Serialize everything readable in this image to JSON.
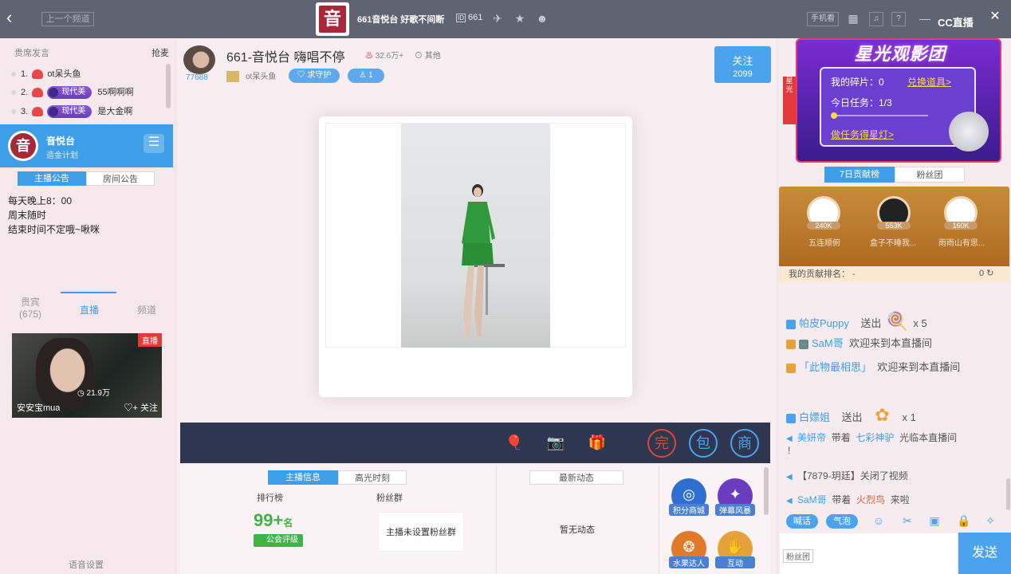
{
  "topbar": {
    "back_icon": "chevron-left-icon",
    "prev_channel": "上一个频道",
    "channel_logo_text": "音",
    "channel_title": "661音悦台 好歌不间断",
    "channel_id": "661",
    "phone_view": "手机看",
    "cc_logo": "CC直播"
  },
  "left": {
    "header_left": "贵席发言",
    "header_right": "抢麦",
    "ranks": [
      {
        "no": "1.",
        "name": "ot呆头鱼",
        "badge": "",
        "msg": ""
      },
      {
        "no": "2.",
        "name": "",
        "badge": "现代美",
        "msg": "55啊啊啊"
      },
      {
        "no": "3.",
        "name": "",
        "badge": "现代美",
        "msg": "是大金啊"
      }
    ],
    "channel_name": "音悦台",
    "channel_sub": "造金计划",
    "tabs": [
      "主播公告",
      "房间公告"
    ],
    "notices": [
      "每天晚上8：00",
      "周末随时",
      "结束时间不定哦~啾咪"
    ],
    "bottom_tabs": [
      {
        "label": "贵宾",
        "count": "(675)"
      },
      {
        "label": "直播",
        "count": ""
      },
      {
        "label": "频道",
        "count": ""
      }
    ],
    "live_card": {
      "tag": "直播",
      "name": "安安宝mua",
      "views": "21.9万",
      "follow": "关注"
    },
    "voice_settings": "语音设置"
  },
  "room": {
    "avatar_number": "77688",
    "title": "661-音悦台 嗨唱不停",
    "popularity": "32.6万+",
    "other": "其他",
    "host": "ot呆头鱼",
    "guard_label": "求守护",
    "fans_count": "1",
    "follow_label": "关注",
    "follow_count": "2099"
  },
  "bottom": {
    "tabs": [
      "主播信息",
      "高光时刻"
    ],
    "rank_label": "排行榜",
    "fans_label": "粉丝群",
    "rank_value": "99+",
    "rank_unit": "名",
    "guild_label": "公会评级",
    "fans_box": "主播未设置粉丝群",
    "news_tab": "最新动态",
    "no_news": "暂无动态",
    "actions": [
      "积分商城",
      "弹幕风暴",
      "水果达人",
      "互动"
    ]
  },
  "right": {
    "banner": {
      "title": "星光观影团",
      "shards_label": "我的碎片：0",
      "exchange": "兑换道具>",
      "task": "今日任务：1/3",
      "do_task": "做任务得星灯>"
    },
    "side_promo": "星光",
    "tabs": [
      "7日贡献榜",
      "粉丝团"
    ],
    "medals": [
      {
        "count": "240K",
        "name": "五连顺俯"
      },
      {
        "count": "553K",
        "name": "盒子不睡我..."
      },
      {
        "count": "160K",
        "name": "雨雨山有思..."
      }
    ],
    "my_rank": "我的贡献排名：  -",
    "my_rank_value": "0",
    "chat": [
      {
        "user": "帕皮Puppy",
        "action": "送出",
        "qty": "x 5"
      },
      {
        "user": "SaM哥",
        "action": "欢迎来到本直播间",
        "qty": ""
      },
      {
        "user": "「此物最相思」",
        "action": "欢迎来到本直播间",
        "qty": ""
      },
      {
        "user": "白嫖姐",
        "action": "送出",
        "qty": "x 1"
      },
      {
        "user": "美妍帝",
        "action": "带着",
        "extra": "七彩神驴",
        "tail": "光临本直播间",
        "line2": "!"
      },
      {
        "user": "【7879-玥廷】关闭了视频",
        "action": "",
        "qty": ""
      },
      {
        "user": "SaM哥",
        "action": "带着",
        "extra": "火烈鸟",
        "tail": "来啦"
      }
    ],
    "btn_cheer": "喊话",
    "btn_bubble": "气泡",
    "fan_club": "粉丝团",
    "send": "发送"
  },
  "colors": {
    "accent": "#4aa3ec",
    "topbar": "#5f6473",
    "giftbar": "#2f3750"
  }
}
